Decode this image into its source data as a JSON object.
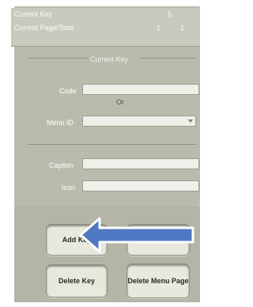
{
  "key_info": {
    "current_key_label": "Current Key",
    "current_key_value": "5",
    "current_page_total_label": "Current Page/Total",
    "current_page_value": "1",
    "total_value": "1"
  },
  "current_key_section": {
    "title": "Current Key",
    "code_label": "Code",
    "code_value": "",
    "or_text": "Or",
    "menu_id_label": "Menu ID",
    "menu_id_value": "",
    "caption_label": "Caption",
    "caption_value": "",
    "icon_label": "Icon",
    "icon_value": ""
  },
  "buttons": {
    "add_key": "Add Key",
    "delete_key": "Delete Key",
    "delete_menu_page": "Delete Menu Page"
  },
  "colors": {
    "arrow_fill": "#4f79c2",
    "arrow_outline": "#ffffff"
  }
}
